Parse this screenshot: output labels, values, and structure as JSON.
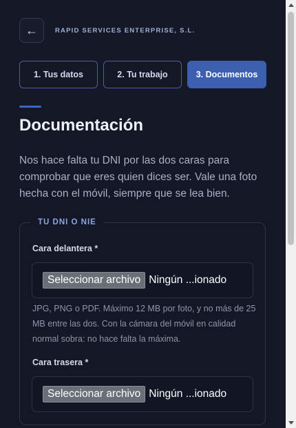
{
  "header": {
    "back_icon": "←",
    "company": "RAPID SERVICES ENTERPRISE, S.L."
  },
  "steps": [
    {
      "label": "1. Tus datos",
      "active": false
    },
    {
      "label": "2. Tu trabajo",
      "active": false
    },
    {
      "label": "3. Documentos",
      "active": true
    }
  ],
  "page": {
    "title": "Documentación",
    "intro": "Nos hace falta tu DNI por las dos caras para comprobar que eres quien dices ser. Vale una foto hecha con el móvil, siempre que se lea bien."
  },
  "dni_section": {
    "legend": "TU DNI O NIE",
    "front": {
      "label": "Cara delantera *",
      "button": "Seleccionar archivo",
      "status": "Ningún ...ionado"
    },
    "help": "JPG, PNG o PDF. Máximo 12 MB por foto, y no más de 25 MB entre las dos. Con la cámara del móvil en calidad normal sobra: no hace falta la máxima.",
    "back": {
      "label": "Cara trasera *",
      "button": "Seleccionar archivo",
      "status": "Ningún ...ionado"
    }
  },
  "colors": {
    "background": "#141826",
    "accent": "#3c5fb0",
    "text": "#e8ecf4",
    "muted": "#a7b0c4"
  }
}
